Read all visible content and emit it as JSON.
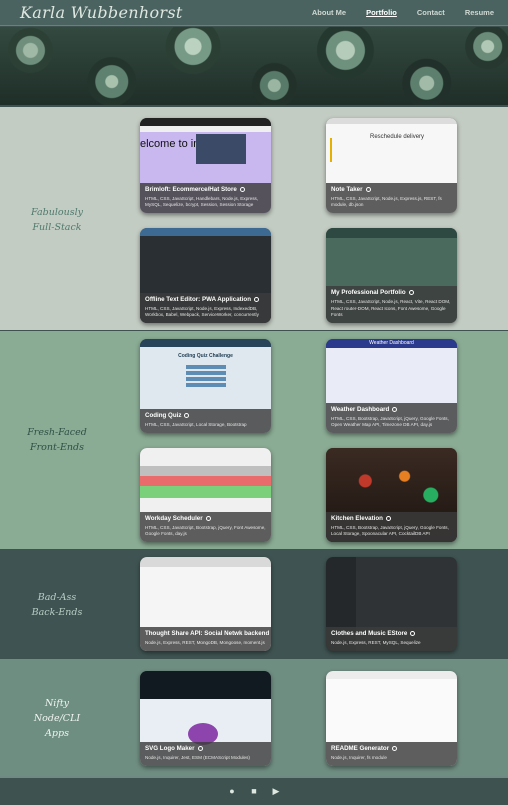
{
  "header": {
    "brand": "Karla Wubbenhorst",
    "nav": [
      {
        "label": "About Me",
        "active": false
      },
      {
        "label": "Portfolio",
        "active": true
      },
      {
        "label": "Contact",
        "active": false
      },
      {
        "label": "Resume",
        "active": false
      }
    ]
  },
  "sections": [
    {
      "title_lines": [
        "Fabulously",
        "Full-Stack"
      ],
      "bg": "#c3ccc3",
      "text_color": "#4f7a6d",
      "cards": [
        {
          "name": "Brimloft: Ecommerce/Hat Store",
          "tech": "HTML, CSS, JavaScript, Handlebars, Node.js, Express, MySQL, Sequelize, bcrypt, Session, Session Storage",
          "shot_text": "elcome to imLoft",
          "shot_bg": "#c9b8ef"
        },
        {
          "name": "Note Taker",
          "tech": "HTML, CSS, JavaScript, Node.js, Express.js, REST, fs module, db.json",
          "shot_text": "Reschedule delivery",
          "shot_bg": "#f4f4f4"
        },
        {
          "name": "Offline Text Editor: PWA Application",
          "tech": "HTML, CSS, JavaScript, Node.js, Express, IndexedDB, Workbox, Babel, Webpack, ServiceWorker, concurrently",
          "shot_text": "",
          "shot_bg": "#2a2f33"
        },
        {
          "name": "My Professional Portfolio",
          "tech": "HTML, CSS, JavaScript, Node.js, React, Vite, React DOM, React router-DOM, React Icons, Font Awesome, Google Fonts",
          "shot_text": "",
          "shot_bg": "#34544a"
        }
      ]
    },
    {
      "title_lines": [
        "Fresh-Faced",
        "Front-Ends"
      ],
      "bg": "#8aab94",
      "text_color": "#2f5146",
      "cards": [
        {
          "name": "Coding Quiz",
          "tech": "HTML, CSS, JavaScript, Local Storage, Bootstrap",
          "shot_text": "Coding Quiz Challenge",
          "shot_bg": "#dfe8ee"
        },
        {
          "name": "Weather Dashboard",
          "tech": "HTML, CSS, Bootstrap, JavaScript, jQuery, Google Fonts, Open Weather Map API, Timezone DB API, day.js",
          "shot_text": "Weather Dashboard",
          "shot_bg": "#e9ecf7"
        },
        {
          "name": "Workday Scheduler",
          "tech": "HTML, CSS, JavaScript, Bootstrap, jQuery, Font Awesome, Google Fonts, day.js",
          "shot_text": "",
          "shot_bg": "#f0f0f0"
        },
        {
          "name": "Kitchen Elevation",
          "tech": "HTML, CSS, Bootstrap, JavaScript, jQuery, Google Fonts, Local Storage, Spoonacular API, CocktailDB API",
          "shot_text": "",
          "shot_bg": "#3a2a22"
        }
      ]
    },
    {
      "title_lines": [
        "Bad-Ass",
        "Back-Ends"
      ],
      "bg": "#3f5452",
      "text_color": "#b9cdc4",
      "cards": [
        {
          "name": "Thought Share API: Social Netwk backend",
          "tech": "Node.js, Express, REST, MongoDB, Mongoose, moment.js",
          "shot_text": "",
          "shot_bg": "#e9e9e9"
        },
        {
          "name": "Clothes and Music EStore",
          "tech": "Node.js, Express, REST, MySQL, Sequelize",
          "shot_text": "",
          "shot_bg": "#2b2f32"
        }
      ]
    },
    {
      "title_lines": [
        "Nifty",
        "Node/CLI",
        "Apps"
      ],
      "bg": "#6f8e82",
      "text_color": "#f1f5f2",
      "cards": [
        {
          "name": "SVG Logo Maker",
          "tech": "Node.js, Inquirer, Jest, ESM (ECMAScript Modules)",
          "shot_text": "",
          "shot_bg": "#1d2a33"
        },
        {
          "name": "README Generator",
          "tech": "Node.js, Inquirer, fs module",
          "shot_text": "",
          "shot_bg": "#f2f2f2"
        }
      ]
    }
  ],
  "footer": {
    "icons": [
      "github-icon",
      "linkedin-icon",
      "youtube-icon"
    ]
  }
}
